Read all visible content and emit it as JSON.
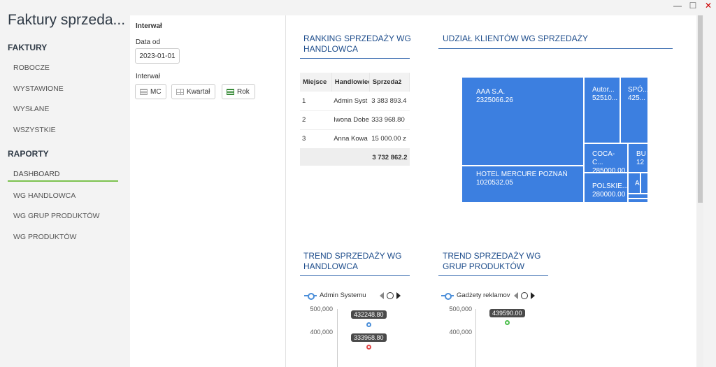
{
  "window": {
    "minimize": "—",
    "maximize": "☐",
    "close": "✕"
  },
  "app_title": "Faktury sprzeda...",
  "sidebar": {
    "faktury_header": "FAKTURY",
    "faktury_items": [
      "ROBOCZE",
      "WYSTAWIONE",
      "WYSŁANE",
      "WSZYSTKIE"
    ],
    "raporty_header": "RAPORTY",
    "raporty_items": [
      "DASHBOARD",
      "WG HANDLOWCA",
      "WG GRUP PRODUKTÓW",
      "WG PRODUKTÓW"
    ],
    "active_item": "DASHBOARD"
  },
  "filters": {
    "interwal_title": "Interwał",
    "date_from_label": "Data od",
    "date_from_value": "2023-01-01",
    "interwal_label": "Interwał",
    "buttons": [
      "MC",
      "Kwartał",
      "Rok"
    ]
  },
  "ranking": {
    "title_line1": "RANKING SPRZEDAŻY WG",
    "title_line2": "HANDLOWCA",
    "columns": [
      "Miejsce",
      "Handlowiec",
      "Sprzedaż"
    ],
    "rows": [
      [
        "1",
        "Admin Syst",
        "3 383 893.4"
      ],
      [
        "2",
        "Iwona Dobe",
        "333 968.80"
      ],
      [
        "3",
        "Anna Kowa",
        "15 000.00 z"
      ]
    ],
    "total": "3 732 862.2"
  },
  "clients_share": {
    "title": "UDZIAŁ KLIENTÓW WG SPRZEDAŻY",
    "tiles": [
      {
        "name": "AAA S.A.",
        "value": "2325066.26"
      },
      {
        "name": "HOTEL MERCURE POZNAŃ",
        "value": "1020532.05"
      },
      {
        "name": "Autor...",
        "value": "52510..."
      },
      {
        "name": "SPÓ...",
        "value": "425..."
      },
      {
        "name": "COCA-C...",
        "value": "285000.00"
      },
      {
        "name": "BU",
        "value": "12"
      },
      {
        "name": "POLSKIE...",
        "value": "280000.00"
      },
      {
        "name": "A",
        "value": ""
      }
    ]
  },
  "trend_handlowca": {
    "title_line1": "TREND SPRZEDAŻY WG",
    "title_line2": "HANDLOWCA",
    "legend": "Admin Systemu",
    "y_ticks": [
      "500,000",
      "400,000"
    ],
    "points": [
      {
        "label": "432248.80",
        "value": 432248.8,
        "color": "#4a8ed9"
      },
      {
        "label": "333968.80",
        "value": 333968.8,
        "color": "#e04848"
      }
    ]
  },
  "trend_grup": {
    "title_line1": "TREND SPRZEDAŻY WG",
    "title_line2": "GRUP PRODUKTÓW",
    "legend": "Gadżety reklamov",
    "y_ticks": [
      "500,000",
      "400,000"
    ],
    "points": [
      {
        "label": "439590.00",
        "value": 439590.0,
        "color": "#4cbf4c"
      }
    ]
  }
}
